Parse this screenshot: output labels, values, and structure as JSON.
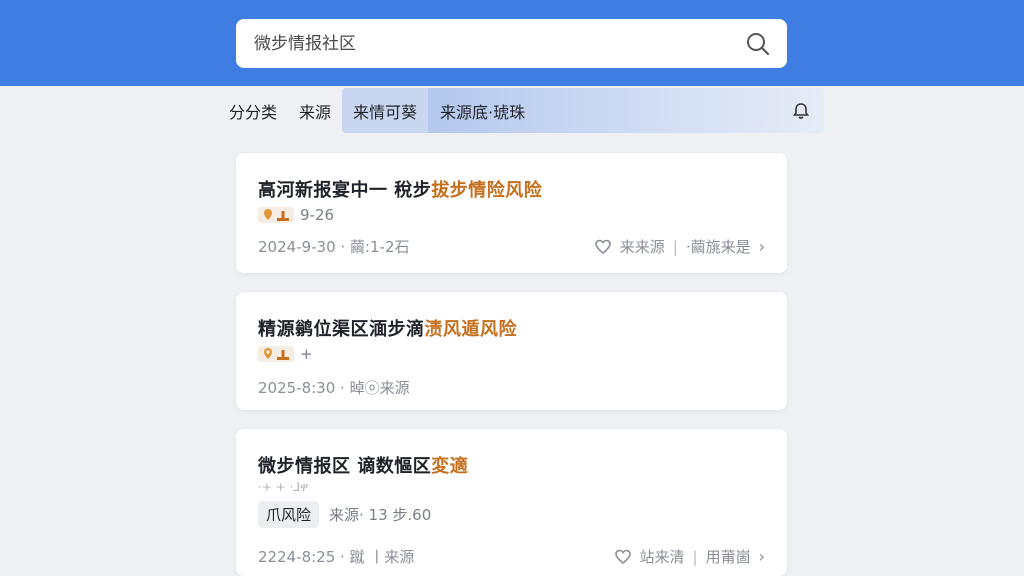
{
  "search": {
    "placeholder": "微步情报社区"
  },
  "tabs": [
    {
      "label": "分分类"
    },
    {
      "label": "来源"
    },
    {
      "label": "来情可葵"
    },
    {
      "label": "来源底·琥珠"
    }
  ],
  "cards": [
    {
      "title_main": "高河新报宴中一 稅步",
      "title_highlight": "拔步情险风险",
      "meta_value": "9-26",
      "date": "2024-9-30 · 繭:1-2石",
      "action1": "来来源",
      "action2": "·繭旐来是"
    },
    {
      "title_main": "精源鹟位渠区湎步滴",
      "title_highlight": "渍风遁风险",
      "meta_value": "+",
      "date": "2025-8:30 · 晫ⓞ来源"
    },
    {
      "title_main": "微步情报区 谪数慪区",
      "title_highlight": "変適",
      "meta_value": "·+ + ·⅃ዋ",
      "badge": "爪风险",
      "source": "来源· 13 步.60",
      "date": "2224-8:25 · 蹴 丨来源",
      "action1": "站来清",
      "action2": "用莆崮"
    }
  ],
  "colors": {
    "header": "#3f7de3",
    "highlight": "#c6701f"
  }
}
